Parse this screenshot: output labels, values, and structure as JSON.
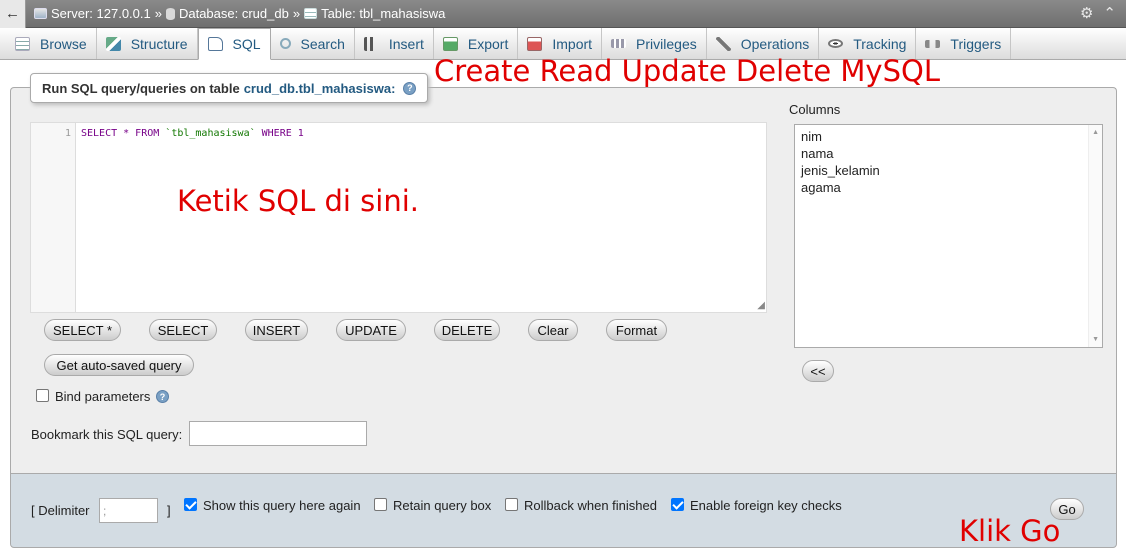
{
  "breadcrumb": {
    "back": "←",
    "server": "Server: 127.0.0.1",
    "database": "Database: crud_db",
    "table": "Table: tbl_mahasiswa",
    "separator": "»"
  },
  "top_icons": {
    "settings": "⚙",
    "collapse": "⌃"
  },
  "tabs": [
    {
      "label": "Browse",
      "icon": "browse-icon",
      "active": false
    },
    {
      "label": "Structure",
      "icon": "structure-icon",
      "active": false
    },
    {
      "label": "SQL",
      "icon": "sql-icon",
      "active": true
    },
    {
      "label": "Search",
      "icon": "search-icon",
      "active": false
    },
    {
      "label": "Insert",
      "icon": "insert-icon",
      "active": false
    },
    {
      "label": "Export",
      "icon": "export-icon",
      "active": false
    },
    {
      "label": "Import",
      "icon": "import-icon",
      "active": false
    },
    {
      "label": "Privileges",
      "icon": "privileges-icon",
      "active": false
    },
    {
      "label": "Operations",
      "icon": "operations-icon",
      "active": false
    },
    {
      "label": "Tracking",
      "icon": "tracking-icon",
      "active": false
    },
    {
      "label": "Triggers",
      "icon": "triggers-icon",
      "active": false
    }
  ],
  "annotations": {
    "title": "Create Read Update Delete MySQL",
    "type_here": "Ketik SQL di sini.",
    "click_go": "Klik Go",
    "color": "#e00000"
  },
  "legend": {
    "prefix": "Run SQL query/queries on table",
    "table": "crud_db.tbl_mahasiswa:",
    "help": "?"
  },
  "editor": {
    "line_number": "1",
    "code_keyword1": "SELECT * FROM ",
    "code_table": "`tbl_mahasiswa`",
    "code_keyword2": " WHERE 1",
    "resize": "◢"
  },
  "query_buttons": {
    "select_star": "SELECT *",
    "select": "SELECT",
    "insert": "INSERT",
    "update": "UPDATE",
    "delete": "DELETE",
    "clear": "Clear",
    "format": "Format",
    "autosaved": "Get auto-saved query"
  },
  "bind_parameters": {
    "label": "Bind parameters",
    "checked": false,
    "help": "?"
  },
  "bookmark": {
    "label": "Bookmark this SQL query:",
    "value": ""
  },
  "columns": {
    "label": "Columns",
    "items": [
      "nim",
      "nama",
      "jenis_kelamin",
      "agama"
    ],
    "insert_button": "<<"
  },
  "footer": {
    "delimiter_open": "[ Delimiter",
    "delimiter_value": ";",
    "delimiter_close": "]",
    "show_query": {
      "label": "Show this query here again",
      "checked": true
    },
    "retain_box": {
      "label": "Retain query box",
      "checked": false
    },
    "rollback": {
      "label": "Rollback when finished",
      "checked": false
    },
    "foreign_keys": {
      "label": "Enable foreign key checks",
      "checked": true
    },
    "go": "Go"
  }
}
